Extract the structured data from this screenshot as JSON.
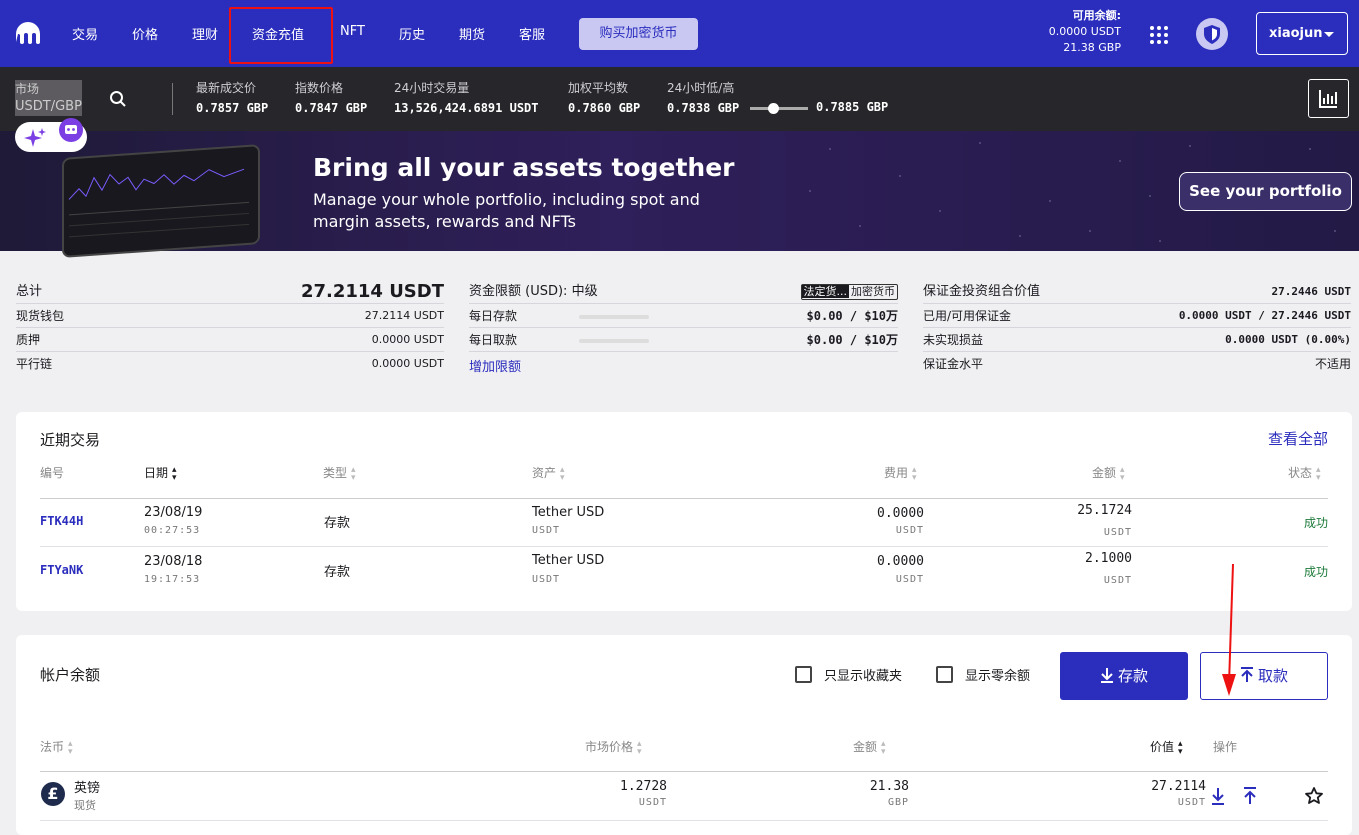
{
  "nav": {
    "links": [
      "交易",
      "价格",
      "理财",
      "资金充值",
      "NFT",
      "历史",
      "期货",
      "客服"
    ],
    "buy_label": "购买加密货币",
    "balance_title": "可用余额:",
    "balance_usdt": "0.0000 USDT",
    "balance_gbp": "21.38 GBP",
    "username": "xiaojun",
    "colors": {
      "brand": "#2b2dbd",
      "highlight_box": "#e11111"
    }
  },
  "ticker": {
    "market_label": "市场",
    "market_pair": "USDT/GBP",
    "items": [
      {
        "label": "最新成交价",
        "value": "0.7857 GBP"
      },
      {
        "label": "指数价格",
        "value": "0.7847 GBP"
      },
      {
        "label": "24小时交易量",
        "value": "13,526,424.6891 USDT"
      },
      {
        "label": "加权平均数",
        "value": "0.7860 GBP"
      },
      {
        "label": "24小时低/高",
        "value": "0.7838 GBP"
      }
    ],
    "high_value": "0.7885 GBP"
  },
  "banner": {
    "title": "Bring all your assets together",
    "subtitle": "Manage your whole portfolio, including spot and margin assets, rewards and NFTs",
    "button": "See your portfolio"
  },
  "summary": {
    "total_label": "总计",
    "total_value": "27.2114 USDT",
    "rows": [
      {
        "label": "现货钱包",
        "value": "27.2114 USDT"
      },
      {
        "label": "质押",
        "value": "0.0000 USDT"
      },
      {
        "label": "平行链",
        "value": "0.0000 USDT"
      }
    ],
    "limits_title": "资金限额 (USD): 中级",
    "toggle_fiat": "法定货...",
    "toggle_crypto": "加密货币",
    "limits": [
      {
        "label": "每日存款",
        "value": "$0.00 / $10万"
      },
      {
        "label": "每日取款",
        "value": "$0.00 / $10万"
      }
    ],
    "increase_link": "增加限额",
    "margin_title": "保证金投资组合价值",
    "margin_total": "27.2446 USDT",
    "margin_rows": [
      {
        "label": "已用/可用保证金",
        "value": "0.0000 USDT / 27.2446 USDT"
      },
      {
        "label": "未实现损益",
        "value": "0.0000 USDT (0.00%)"
      },
      {
        "label": "保证金水平",
        "value": "不适用"
      }
    ]
  },
  "recent": {
    "title": "近期交易",
    "view_all": "查看全部",
    "headers": [
      "编号",
      "日期",
      "类型",
      "资产",
      "费用",
      "金额",
      "状态"
    ],
    "rows": [
      {
        "id": "FTK44H",
        "date": "23/08/19",
        "time": "00:27:53",
        "type": "存款",
        "asset": "Tether USD",
        "asset_code": "USDT",
        "fee": "0.0000",
        "fee_unit": "USDT",
        "amount": "25.1724",
        "amount_unit": "USDT",
        "status": "成功"
      },
      {
        "id": "FTYaNK",
        "date": "23/08/18",
        "time": "19:17:53",
        "type": "存款",
        "asset": "Tether USD",
        "asset_code": "USDT",
        "fee": "0.0000",
        "fee_unit": "USDT",
        "amount": "2.1000",
        "amount_unit": "USDT",
        "status": "成功"
      }
    ]
  },
  "balances": {
    "title": "帐户余额",
    "favorites_label": "只显示收藏夹",
    "zero_label": "显示零余额",
    "deposit_label": "存款",
    "withdraw_label": "取款",
    "headers": [
      "法币",
      "市场价格",
      "金额",
      "价值",
      "操作"
    ],
    "rows": [
      {
        "name": "英镑",
        "kind": "现货",
        "price": "1.2728",
        "price_unit": "USDT",
        "amount": "21.38",
        "amount_unit": "GBP",
        "value": "27.2114",
        "value_unit": "USDT"
      }
    ]
  }
}
